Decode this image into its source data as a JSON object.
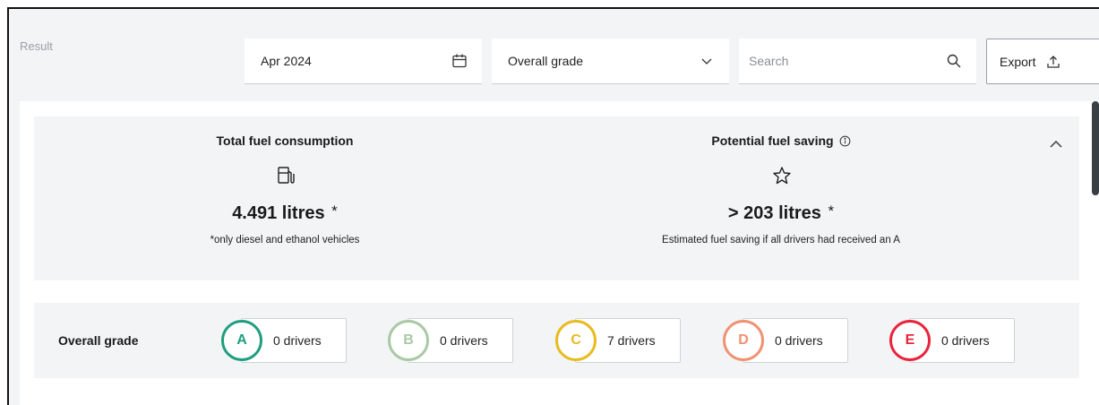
{
  "header": {
    "result_label": "Result",
    "date_value": "Apr 2024",
    "grade_select_value": "Overall grade",
    "search_placeholder": "Search",
    "export_label": "Export"
  },
  "summary": {
    "fuel_consumption": {
      "title": "Total fuel consumption",
      "value": "4.491 litres",
      "asterisk": "*",
      "note": "*only diesel and ethanol vehicles",
      "icon": "fuel-pump-icon"
    },
    "fuel_saving": {
      "title": "Potential fuel saving",
      "value": "> 203 litres",
      "asterisk": "*",
      "note": "Estimated fuel saving if all drivers had received an A",
      "icon": "star-icon"
    }
  },
  "grades": {
    "label": "Overall grade",
    "items": [
      {
        "letter": "A",
        "count": "0 drivers",
        "color": "#1f9e7e"
      },
      {
        "letter": "B",
        "count": "0 drivers",
        "color": "#a9c9a6"
      },
      {
        "letter": "C",
        "count": "7 drivers",
        "color": "#e8bb1f"
      },
      {
        "letter": "D",
        "count": "0 drivers",
        "color": "#ef9272"
      },
      {
        "letter": "E",
        "count": "0 drivers",
        "color": "#e8243c"
      }
    ]
  }
}
